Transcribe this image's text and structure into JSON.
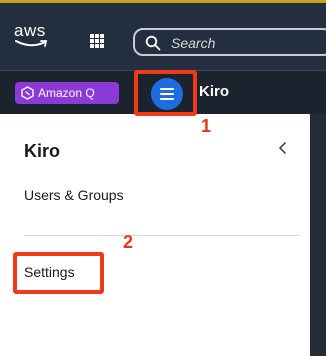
{
  "header": {
    "logo_text": "aws",
    "services_icon": "grid-icon",
    "search": {
      "icon": "search-icon",
      "placeholder": "Search"
    }
  },
  "subheader": {
    "amazon_q_label": "Amazon Q",
    "amazon_q_color": "#8b3ad8",
    "menu_icon": "hamburger-menu-icon",
    "service_name": "Kiro"
  },
  "sidenav": {
    "title": "Kiro",
    "collapse_icon": "chevron-left-icon",
    "items": [
      {
        "label": "Users & Groups"
      },
      {
        "label": "Settings"
      }
    ]
  },
  "annotations": {
    "callout_1": "1",
    "callout_2": "2",
    "highlight_color": "#f03a17"
  }
}
